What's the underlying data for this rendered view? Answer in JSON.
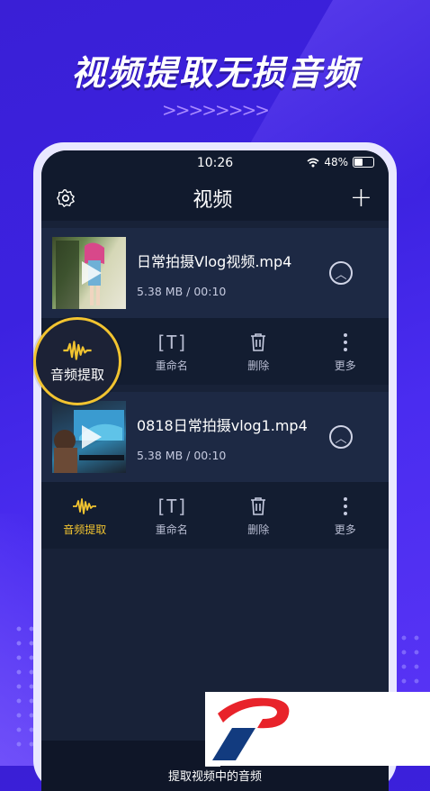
{
  "headline": "视频提取无损音频",
  "chevrons": ">>>>>>>>",
  "status": {
    "time": "10:26",
    "battery": "48%"
  },
  "nav": {
    "title": "视频"
  },
  "videos": [
    {
      "name": "日常拍摄Vlog视频.mp4",
      "meta": "5.38 MB / 00:10"
    },
    {
      "name": "0818日常拍摄vlog1.mp4",
      "meta": "5.38 MB / 00:10"
    }
  ],
  "actions": {
    "extract": "音频提取",
    "rename": "重命名",
    "delete": "删除",
    "more": "更多",
    "rename_icon": "[T]"
  },
  "bottom_tab": {
    "label": "提取视频中的音频"
  },
  "colors": {
    "accent_gold": "#f2c430",
    "screen_bg": "#182238",
    "brand_red": "#e8232a",
    "brand_blue": "#123b7f"
  }
}
